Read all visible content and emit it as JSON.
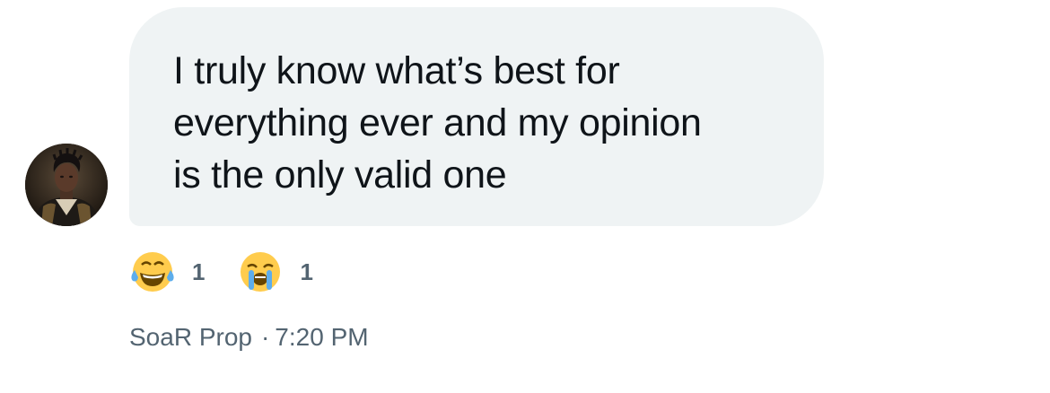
{
  "message": {
    "lines": [
      "I truly know what’s best for",
      "everything ever and my opinion",
      "is the only valid one"
    ]
  },
  "avatar": {
    "icon": "user-avatar-portrait"
  },
  "reactions": [
    {
      "emoji": "😂",
      "icon": "tears-of-joy-emoji-icon",
      "count": "1"
    },
    {
      "emoji": "😭",
      "icon": "loudly-crying-emoji-icon",
      "count": "1"
    }
  ],
  "meta": {
    "sender": "SoaR Prop",
    "separator": "·",
    "time": "7:20 PM"
  },
  "colors": {
    "bubble": "#eff3f4",
    "text": "#0f1419",
    "secondary": "#536471"
  }
}
